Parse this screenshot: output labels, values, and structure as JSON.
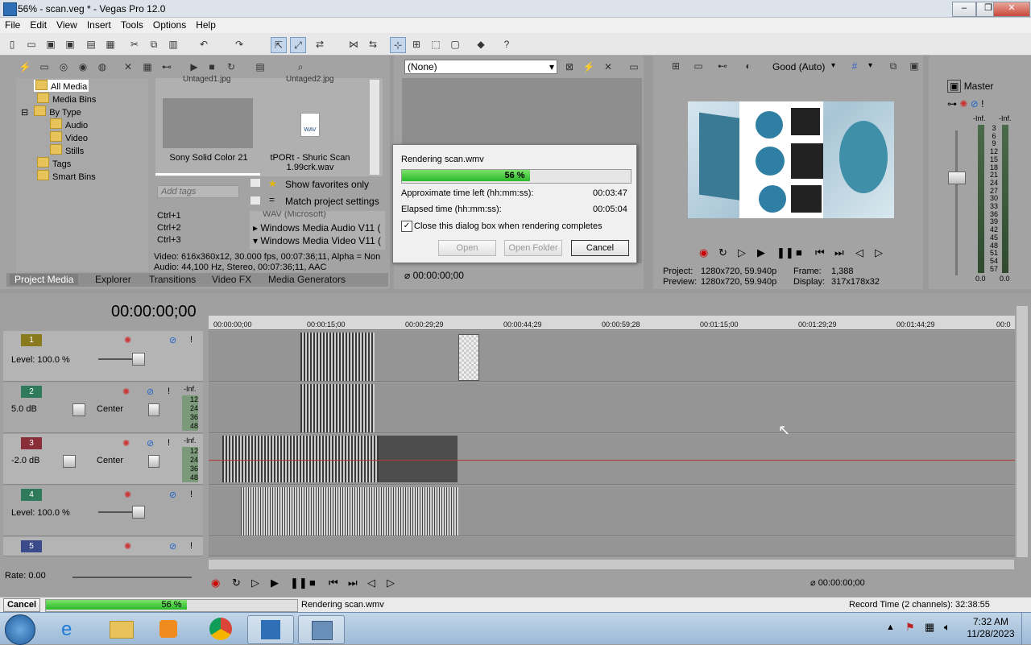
{
  "window": {
    "title": "56% - scan.veg * - Vegas Pro 12.0",
    "min": "–",
    "max": "❐",
    "close": "✕"
  },
  "menu": [
    "File",
    "Edit",
    "View",
    "Insert",
    "Tools",
    "Options",
    "Help"
  ],
  "explorer": {
    "tree": [
      {
        "label": "All Media",
        "level": 1,
        "selected": true
      },
      {
        "label": "Media Bins",
        "level": 1
      },
      {
        "label": "By Type",
        "level": 1,
        "expander": "⊟"
      },
      {
        "label": "Audio",
        "level": 2
      },
      {
        "label": "Video",
        "level": 2
      },
      {
        "label": "Stills",
        "level": 2
      },
      {
        "label": "Tags",
        "level": 1
      },
      {
        "label": "Smart Bins",
        "level": 1
      }
    ],
    "top_clipped_left": "Untaged1.jpg",
    "top_clipped_right": "Untaged2.jpg",
    "media_items": [
      {
        "label": "Sony Solid Color 21"
      },
      {
        "label": "tPORt - Shuric Scan 1.99crk.wav",
        "badge": "WAV"
      }
    ],
    "add_tags_placeholder": "Add tags",
    "show_favorites": "Show favorites only",
    "match_project": "Match project settings",
    "shortcuts": [
      "Ctrl+1",
      "Ctrl+2",
      "Ctrl+3"
    ],
    "formats": [
      "WAV (Microsoft)",
      "Windows Media Audio V11 (",
      "Windows Media Video V11 ("
    ],
    "info_line1": "Video: 616x360x12, 30.000 fps, 00:07:36;11, Alpha = Non",
    "info_line2": "Audio: 44,100 Hz, Stereo, 00:07:36;11, AAC",
    "tabs": [
      "Project Media",
      "Explorer",
      "Transitions",
      "Video FX",
      "Media Generators"
    ]
  },
  "trimmer": {
    "dropdown": "(None)",
    "timecode": "00:00:00;00"
  },
  "preview": {
    "quality": "Good (Auto)",
    "project_label": "Project:",
    "project": "1280x720, 59.940p",
    "preview_label": "Preview:",
    "preview": "1280x720, 59.940p",
    "frame_label": "Frame:",
    "frame": "1,388",
    "display_label": "Display:",
    "display": "317x178x32"
  },
  "mixer": {
    "master": "Master",
    "inf_l": "-Inf.",
    "inf_r": "-Inf.",
    "scale": [
      "3",
      "6",
      "9",
      "12",
      "15",
      "18",
      "21",
      "24",
      "27",
      "30",
      "33",
      "36",
      "39",
      "42",
      "45",
      "48",
      "51",
      "54",
      "57"
    ],
    "zero_l": "0.0",
    "zero_r": "0.0"
  },
  "render_dialog": {
    "title": "Rendering scan.wmv",
    "progress": 0.56,
    "progress_text": "56 %",
    "time_left_label": "Approximate time left (hh:mm:ss):",
    "time_left": "00:03:47",
    "elapsed_label": "Elapsed time (hh:mm:ss):",
    "elapsed": "00:05:04",
    "close_checkbox": "Close this dialog box when rendering completes",
    "btn_open": "Open",
    "btn_open_folder": "Open Folder",
    "btn_cancel": "Cancel"
  },
  "timeline": {
    "cursor_time": "00:00:00;00",
    "ruler": [
      "00:00:00;00",
      "00:00:15;00",
      "00:00:29;29",
      "00:00:44;29",
      "00:00:59;28",
      "00:01:15;00",
      "00:01:29;29",
      "00:01:44;29",
      "00:0"
    ],
    "tracks": [
      {
        "num": "1",
        "kind": "video",
        "level_text": "Level: 100.0 %",
        "color": "#8a7a1e"
      },
      {
        "num": "2",
        "kind": "audio",
        "vol_text": "5.0 dB",
        "pan_text": "Center",
        "inf": "-Inf.",
        "color": "#2e7a5a"
      },
      {
        "num": "3",
        "kind": "audio",
        "vol_text": "-2.0 dB",
        "pan_text": "Center",
        "inf": "-Inf.",
        "color": "#8a2e3a"
      },
      {
        "num": "4",
        "kind": "video",
        "level_text": "Level: 100.0 %",
        "color": "#2e7a5a"
      },
      {
        "num": "5",
        "kind": "video",
        "color": "#3a4a8a"
      }
    ],
    "meter_ticks": [
      "12",
      "24",
      "36",
      "48"
    ],
    "rate": "Rate: 0.00",
    "transport_time": "00:00:00;00"
  },
  "statusbar": {
    "cancel": "Cancel",
    "progress": 0.56,
    "progress_text": "56 %",
    "message": "Rendering scan.wmv",
    "record_time": "Record Time (2 channels): 32:38:55"
  },
  "taskbar": {
    "time": "7:32 AM",
    "date": "11/28/2023"
  }
}
